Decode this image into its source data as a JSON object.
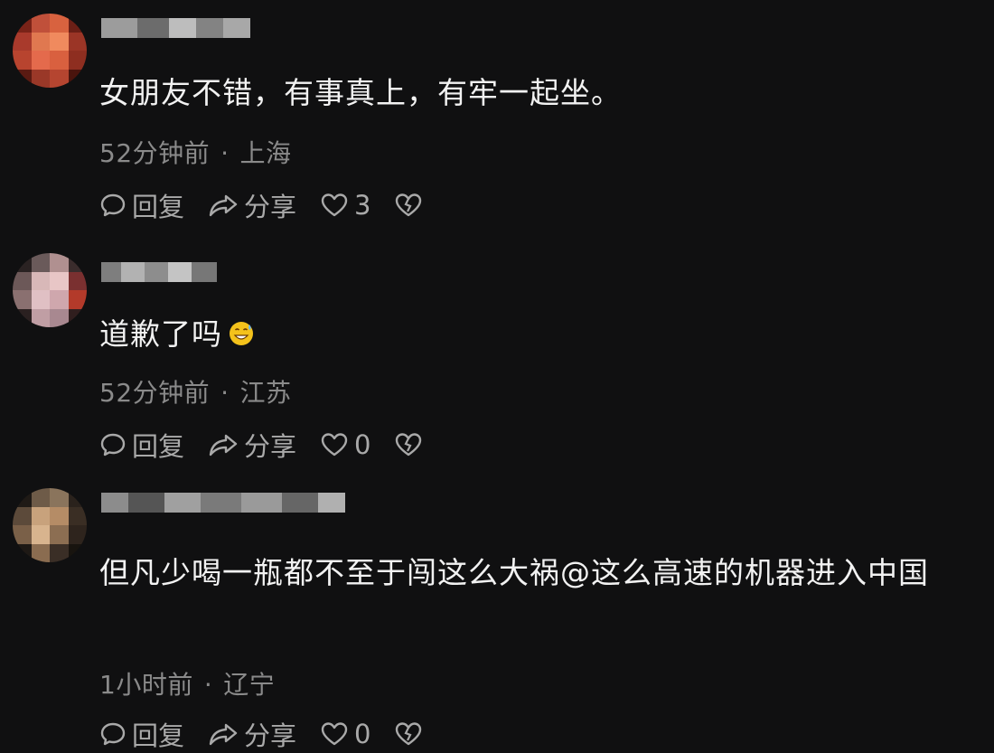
{
  "comments": [
    {
      "content": "女朋友不错，有事真上，有牢一起坐。",
      "time": "52分钟前",
      "location": "上海",
      "reply_label": "回复",
      "share_label": "分享",
      "likes": "3",
      "avatar_colors": [
        "#7a2318",
        "#c0503a",
        "#d8623f",
        "#6b1f16",
        "#a93a2c",
        "#e07850",
        "#f08a5e",
        "#9b3526",
        "#b8442f",
        "#e46a4c",
        "#d9603f",
        "#8e2e20",
        "#5a1a12",
        "#9a3828",
        "#b54530",
        "#4a140d"
      ]
    },
    {
      "content": "道歉了吗",
      "emoji": "grinning-sweat-emoji",
      "time": "52分钟前",
      "location": "江苏",
      "reply_label": "回复",
      "share_label": "分享",
      "likes": "0",
      "avatar_colors": [
        "#2a2222",
        "#6a5a5a",
        "#b09090",
        "#3a2c2c",
        "#6c5858",
        "#d8b8b8",
        "#e8c6c6",
        "#7a3030",
        "#8a7070",
        "#e0c0c4",
        "#cfa7ad",
        "#b33a2a",
        "#2a2020",
        "#c09ea4",
        "#a88890",
        "#301e1e"
      ]
    },
    {
      "content": "但凡少喝一瓶都不至于闯这么大祸@这么高速的机器进入中国",
      "time": "1小时前",
      "location": "辽宁",
      "reply_label": "回复",
      "share_label": "分享",
      "likes": "0",
      "avatar_colors": [
        "#1f1a16",
        "#6e5b48",
        "#8a745c",
        "#2a221c",
        "#5c4a3a",
        "#c8a27c",
        "#b58c66",
        "#3a2e24",
        "#7a6048",
        "#d8b48e",
        "#8c6e52",
        "#2e241d",
        "#1e1915",
        "#8a6c50",
        "#3a2e26",
        "#18140f"
      ]
    }
  ]
}
